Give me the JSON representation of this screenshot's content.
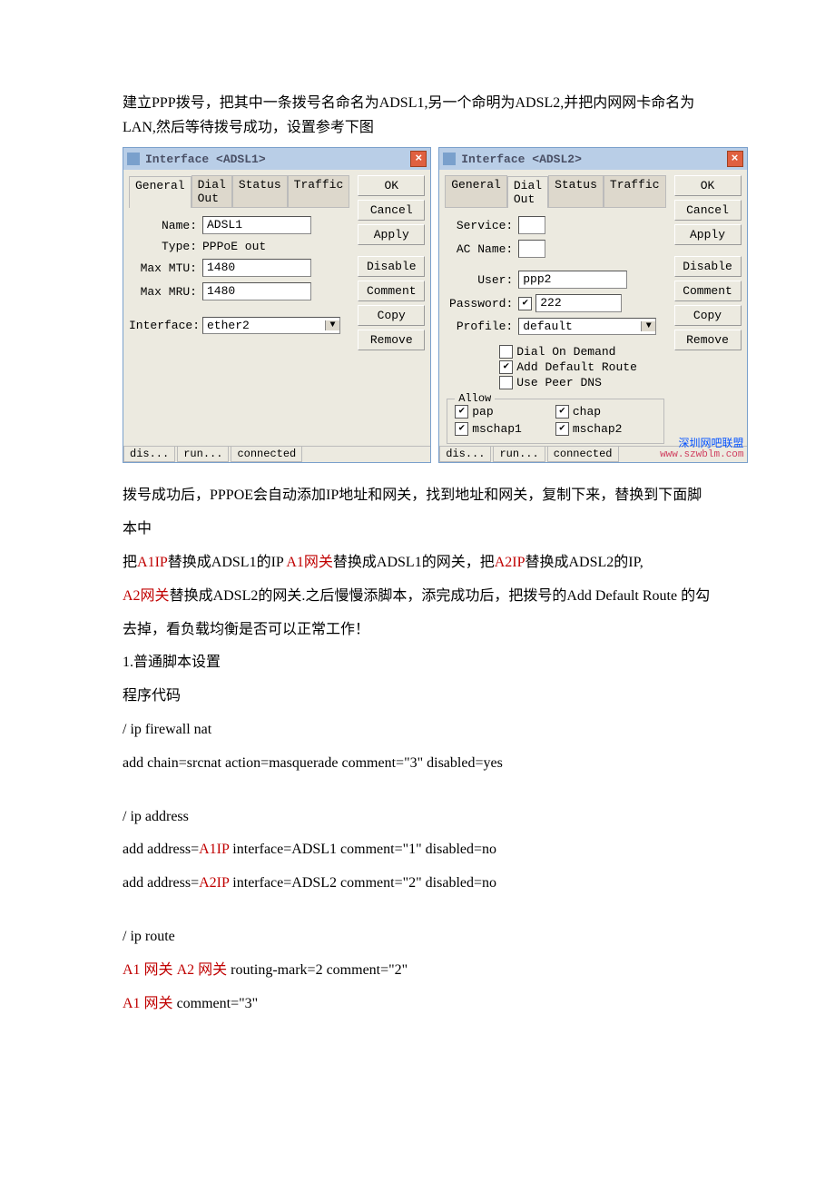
{
  "intro": "建立PPP拨号，把其中一条拨号名命名为ADSL1,另一个命明为ADSL2,并把内网网卡命名为LAN,然后等待拨号成功，设置参考下图",
  "win1": {
    "title": "Interface <ADSL1>",
    "tabs": [
      "General",
      "Dial Out",
      "Status",
      "Traffic"
    ],
    "activeTab": 0,
    "fields": {
      "name_lbl": "Name:",
      "name_val": "ADSL1",
      "type_lbl": "Type:",
      "type_val": "PPPoE out",
      "mtu_lbl": "Max MTU:",
      "mtu_val": "1480",
      "mru_lbl": "Max MRU:",
      "mru_val": "1480",
      "iface_lbl": "Interface:",
      "iface_val": "ether2"
    },
    "buttons": [
      "OK",
      "Cancel",
      "Apply",
      "Disable",
      "Comment",
      "Copy",
      "Remove"
    ],
    "status": [
      "dis...",
      "run...",
      "connected"
    ]
  },
  "win2": {
    "title": "Interface <ADSL2>",
    "tabs": [
      "General",
      "Dial Out",
      "Status",
      "Traffic"
    ],
    "activeTab": 1,
    "fields": {
      "service_lbl": "Service:",
      "service_val": "",
      "acname_lbl": "AC Name:",
      "acname_val": "",
      "user_lbl": "User:",
      "user_val": "ppp2",
      "pass_lbl": "Password:",
      "pass_val": "222",
      "pass_show": true,
      "profile_lbl": "Profile:",
      "profile_val": "default",
      "dialondemand": "Dial On Demand",
      "adddefaultroute": "Add Default Route",
      "usepeerdns": "Use Peer DNS",
      "chk_dod": false,
      "chk_adr": true,
      "chk_upd": false
    },
    "allow_label": "Allow",
    "allow": {
      "pap": "pap",
      "chap": "chap",
      "mschap1": "mschap1",
      "mschap2": "mschap2",
      "chk_pap": true,
      "chk_chap": true,
      "chk_m1": true,
      "chk_m2": true
    },
    "buttons": [
      "OK",
      "Cancel",
      "Apply",
      "Disable",
      "Comment",
      "Copy",
      "Remove"
    ],
    "status": [
      "dis...",
      "run...",
      "connected"
    ],
    "watermark": {
      "l1": "深圳网吧联盟",
      "l2": "www.szwblm.com"
    }
  },
  "body": {
    "p1": "拨号成功后，PPPOE会自动添加IP地址和网关，找到地址和网关，复制下来，替换到下面脚本中",
    "seg": {
      "pre1": "把",
      "a1ip": "A1IP",
      "t2": "替换成ADSL1的IP ",
      "a1gw": "A1网关",
      "t3": "替换成ADSL1的网关，把",
      "a2ip": "A2IP",
      "t4": "替换成ADSL2的IP,",
      "a2gw": "A2网关",
      "t5": "替换成ADSL2的网关.之后慢慢添脚本，添完成功后，把拨号的Add Default Route 的勾去掉，看负载均衡是否可以正常工作！"
    },
    "h1": "1.普通脚本设置",
    "h2": "程序代码",
    "code1": "/ ip firewall nat",
    "code2": "add chain=srcnat action=masquerade comment=\"3\" disabled=yes",
    "code3": "/ ip address",
    "code4_pre": "add address=",
    "code4_r": "A1IP",
    "code4_post": " interface=ADSL1 comment=\"1\" disabled=no",
    "code5_pre": "add address=",
    "code5_r": "A2IP",
    "code5_post": " interface=ADSL2 comment=\"2\" disabled=no",
    "code6": "/ ip route",
    "code7_r1": "A1 网关",
    "code7_sp": "  ",
    "code7_r2": "A2 网关",
    "code7_post": "  routing-mark=2 comment=\"2\"",
    "code8_r": "A1 网关",
    "code8_post": "  comment=\"3\""
  }
}
